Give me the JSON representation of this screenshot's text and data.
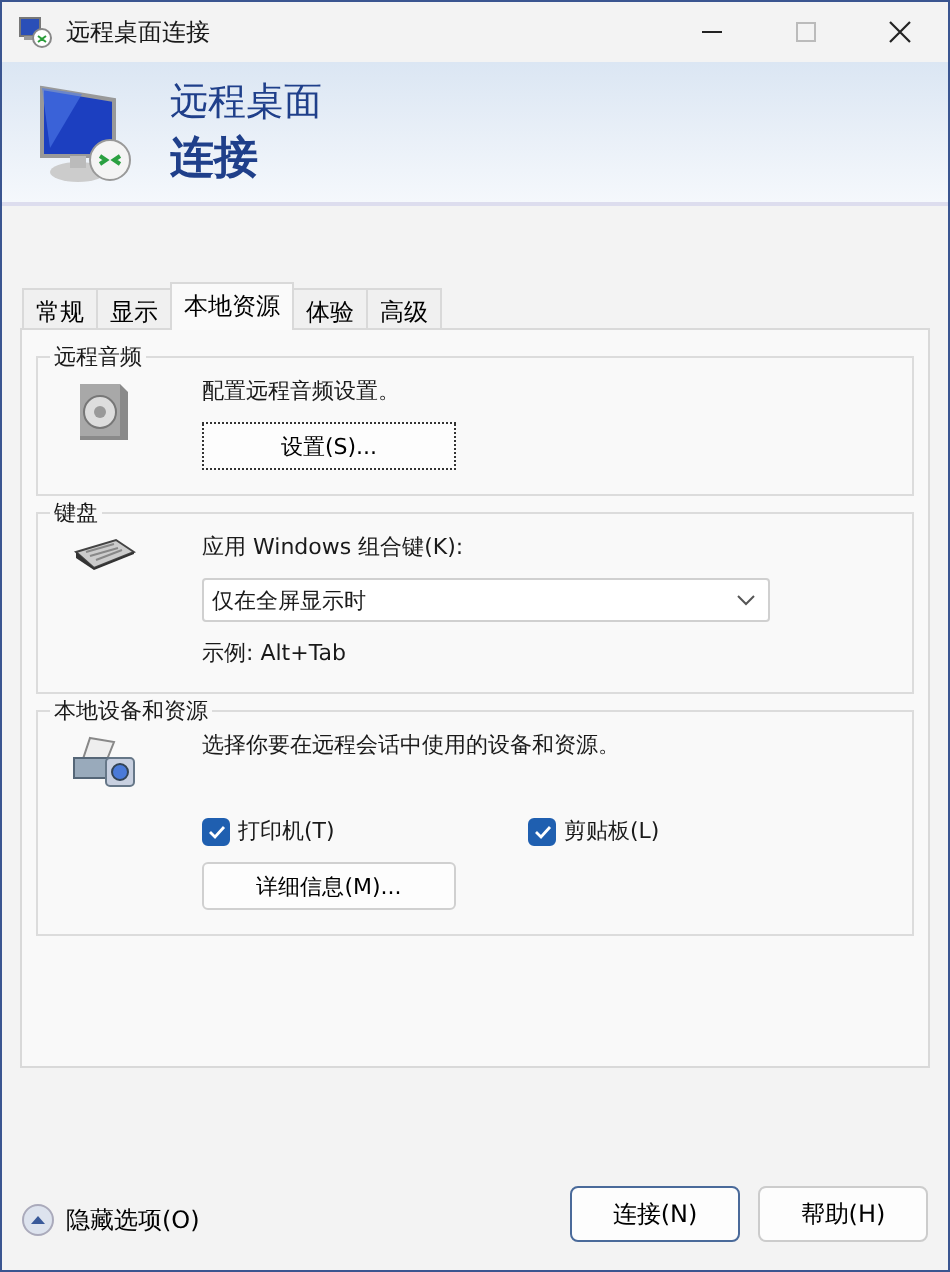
{
  "window": {
    "title": "远程桌面连接"
  },
  "banner": {
    "line1": "远程桌面",
    "line2": "连接"
  },
  "tabs": [
    {
      "label": "常规",
      "selected": false
    },
    {
      "label": "显示",
      "selected": false
    },
    {
      "label": "本地资源",
      "selected": true
    },
    {
      "label": "体验",
      "selected": false
    },
    {
      "label": "高级",
      "selected": false
    }
  ],
  "groups": [
    {
      "kind": "audio",
      "legend": "远程音频",
      "description": "配置远程音频设置。",
      "button": {
        "label": "设置(S)...",
        "focused": true
      }
    },
    {
      "kind": "keyboard",
      "legend": "键盘",
      "label": "应用 Windows 组合键(K):",
      "dropdown": {
        "value": "仅在全屏显示时"
      },
      "example": "示例: Alt+Tab"
    },
    {
      "kind": "devices",
      "legend": "本地设备和资源",
      "description": "选择你要在远程会话中使用的设备和资源。",
      "checkboxes": [
        {
          "label": "打印机(T)",
          "checked": true
        },
        {
          "label": "剪贴板(L)",
          "checked": true
        }
      ],
      "button": {
        "label": "详细信息(M)...",
        "focused": false
      }
    }
  ],
  "footer": {
    "toggle": "隐藏选项(O)",
    "buttons": [
      {
        "label": "连接(N)",
        "default": true
      },
      {
        "label": "帮助(H)",
        "default": false
      }
    ]
  }
}
